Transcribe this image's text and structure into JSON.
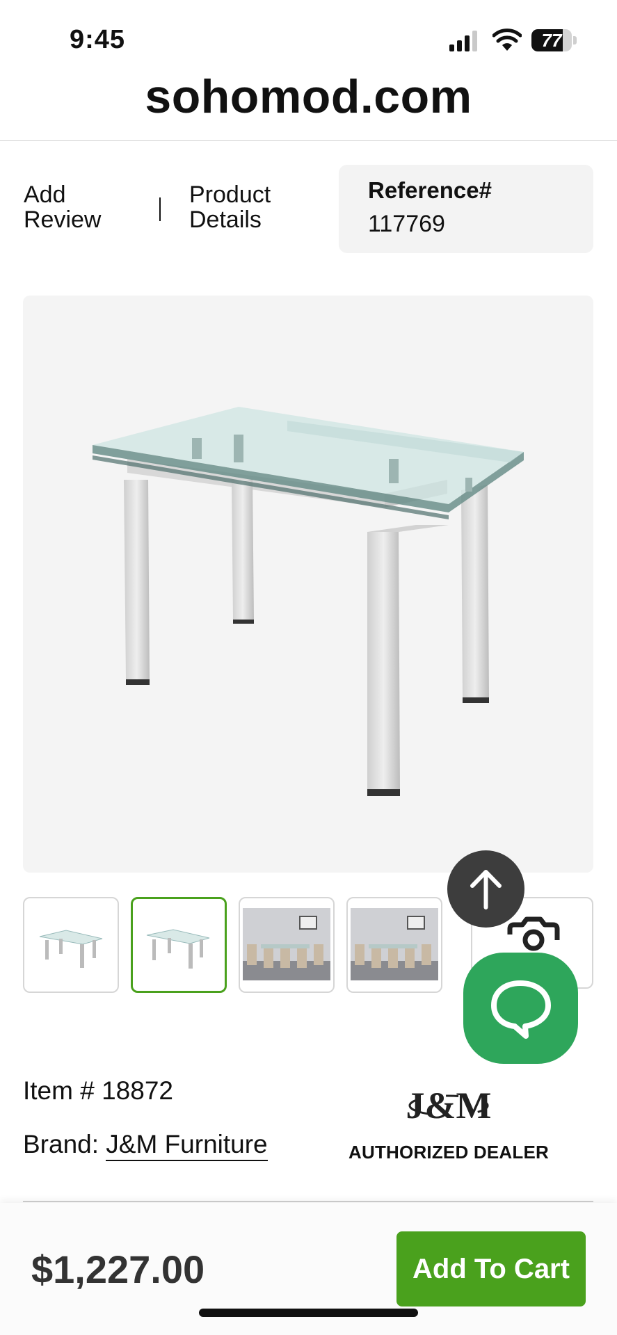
{
  "status_bar": {
    "time": "9:45",
    "battery": "77",
    "battery_level": 0.77
  },
  "site": {
    "domain": "sohomod.com"
  },
  "header": {
    "add_review": "Add Review",
    "separator": "|",
    "product_details": "Product Details",
    "reference_label": "Reference#",
    "reference_value": "117769"
  },
  "product": {
    "item_number": "Item # 18872",
    "brand_label": "Brand:",
    "brand_name": "J&M Furniture",
    "dealer_text": "AUTHORIZED DEALER",
    "logo_text": "J&M"
  },
  "thumbnails": [
    "table-thumbnail",
    "table-thumbnail",
    "dining-room-thumbnail",
    "dining-room-thumbnail",
    "camera-icon"
  ],
  "cart": {
    "price": "$1,227.00",
    "button_label": "Add To Cart"
  },
  "colors": {
    "accent": "#4aa11d",
    "chat": "#2ea65b",
    "scroll_top": "#3d3d3d"
  }
}
